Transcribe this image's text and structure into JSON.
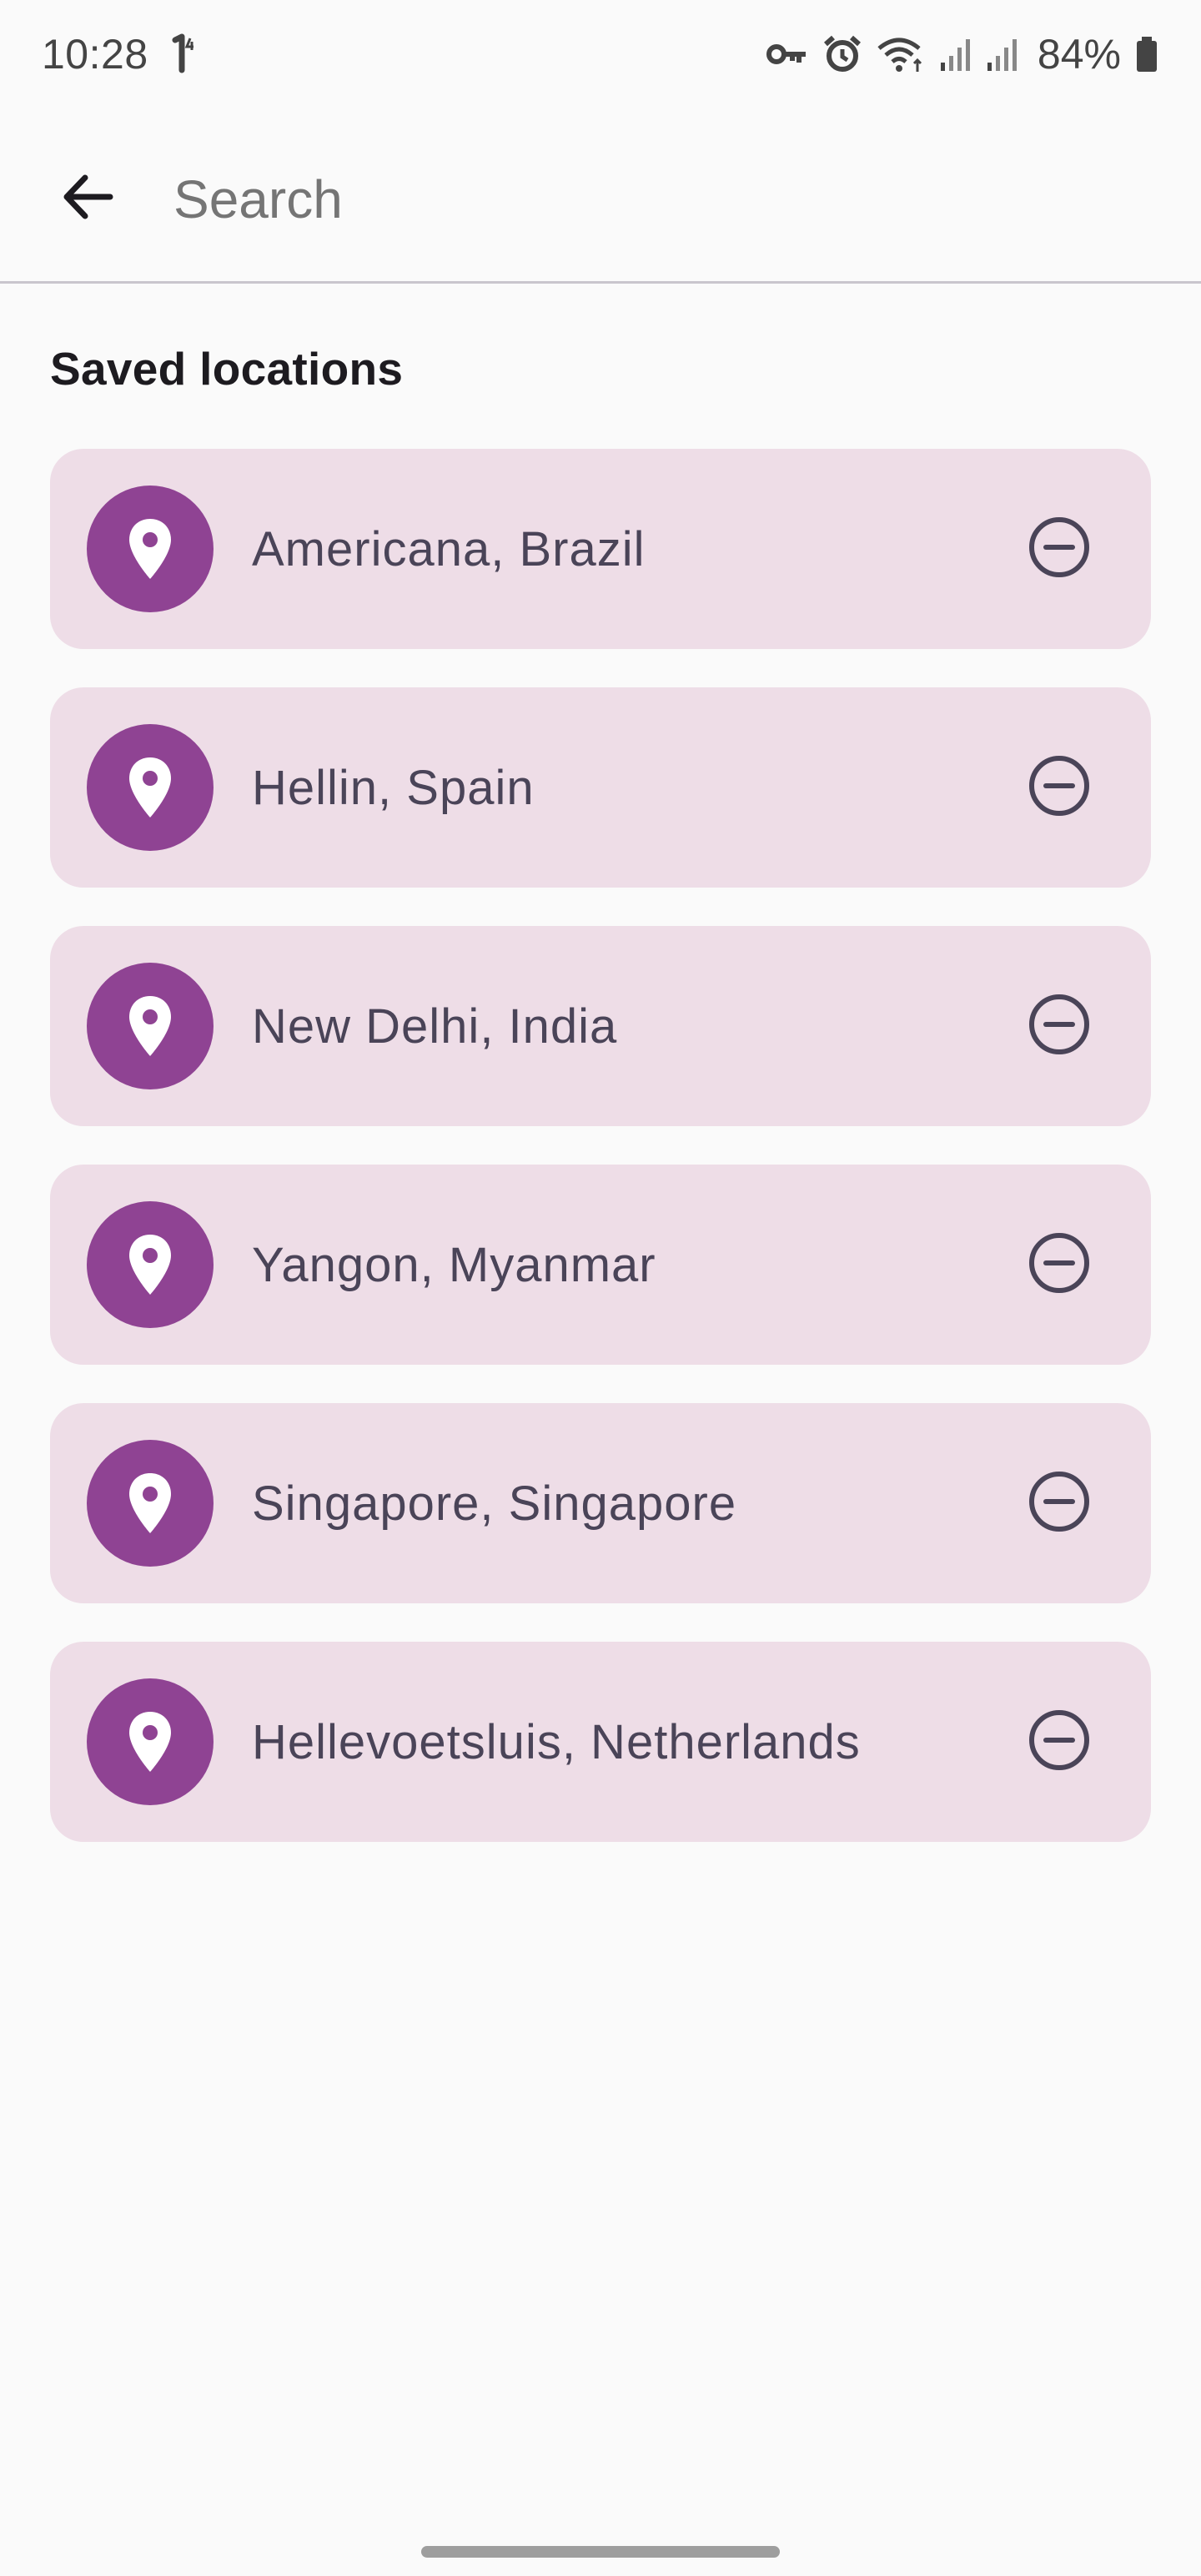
{
  "status_bar": {
    "time": "10:28",
    "battery": "84%",
    "icons": [
      "notification-count-icon",
      "vpn-key-icon",
      "alarm-icon",
      "wifi-icon",
      "signal-icon",
      "signal-icon",
      "battery-icon"
    ]
  },
  "app_bar": {
    "back_icon": "arrow-back-icon",
    "search_placeholder": "Search"
  },
  "section": {
    "title": "Saved locations"
  },
  "locations": [
    {
      "label": "Americana, Brazil"
    },
    {
      "label": "Hellin, Spain"
    },
    {
      "label": "New Delhi, India"
    },
    {
      "label": "Yangon, Myanmar"
    },
    {
      "label": "Singapore, Singapore"
    },
    {
      "label": "Hellevoetsluis, Netherlands"
    }
  ],
  "colors": {
    "card_bg": "#eedde7",
    "pin_bg": "#8f4393",
    "text": "#4a4458"
  }
}
